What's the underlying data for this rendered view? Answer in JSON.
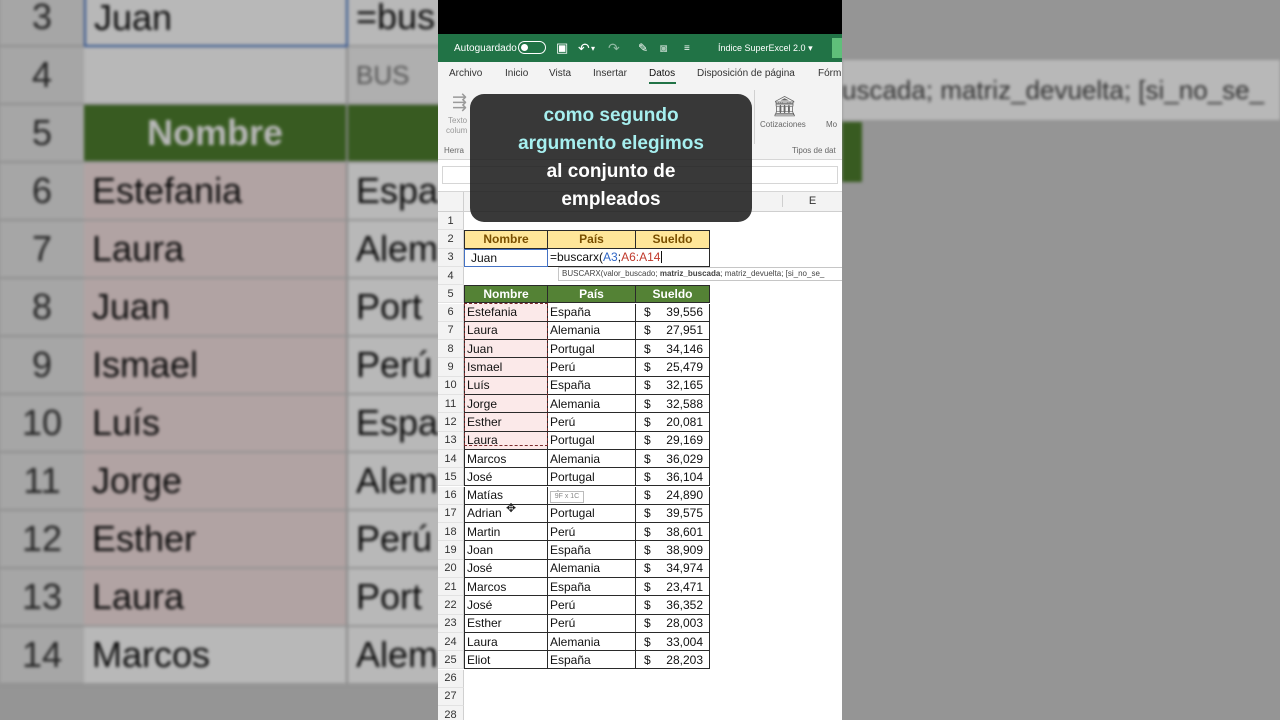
{
  "app": {
    "autosave_label": "Autoguardado",
    "workbook_title": "Índice SuperExcel 2.0",
    "title_chevron": "▾"
  },
  "ribbon": {
    "tabs": [
      "Archivo",
      "Inicio",
      "Vista",
      "Insertar",
      "Datos",
      "Disposición de página",
      "Fórm"
    ],
    "active_tab": "Datos",
    "group_left_btn1": "Texto",
    "group_left_btn2": "colum",
    "group_left_label": "Herra",
    "cotizaciones_label": "Cotizaciones",
    "more_label": "Mo",
    "tipos_label": "Tipos de dat"
  },
  "grid": {
    "col_e_header": "E",
    "lookup_header": [
      "Nombre",
      "País",
      "Sueldo"
    ],
    "lookup_value": "Juan",
    "formula_prefix": "=buscarx(",
    "formula_arg1": "A3",
    "formula_sep": ";",
    "formula_arg2": "A6:A14",
    "tooltip_fn": "BUSCARX(valor_buscado; ",
    "tooltip_bold": "matriz_buscada",
    "tooltip_rest": "; matriz_devuelta; [si_no_se_",
    "table_header": [
      "Nombre",
      "País",
      "Sueldo"
    ],
    "currency": "$",
    "range_size_tip": "9F x 1C",
    "rows": [
      {
        "n": "6",
        "name": "Estefania",
        "country": "España",
        "salary": "39,556"
      },
      {
        "n": "7",
        "name": "Laura",
        "country": "Alemania",
        "salary": "27,951"
      },
      {
        "n": "8",
        "name": "Juan",
        "country": "Portugal",
        "salary": "34,146"
      },
      {
        "n": "9",
        "name": "Ismael",
        "country": "Perú",
        "salary": "25,479"
      },
      {
        "n": "10",
        "name": "Luís",
        "country": "España",
        "salary": "32,165"
      },
      {
        "n": "11",
        "name": "Jorge",
        "country": "Alemania",
        "salary": "32,588"
      },
      {
        "n": "12",
        "name": "Esther",
        "country": "Perú",
        "salary": "20,081"
      },
      {
        "n": "13",
        "name": "Laura",
        "country": "Portugal",
        "salary": "29,169"
      },
      {
        "n": "14",
        "name": "Marcos",
        "country": "Alemania",
        "salary": "36,029"
      },
      {
        "n": "15",
        "name": "José",
        "country": "Portugal",
        "salary": "36,104"
      },
      {
        "n": "16",
        "name": "Matías",
        "country": "nia",
        "salary": "24,890"
      },
      {
        "n": "17",
        "name": "Adrian",
        "country": "Portugal",
        "salary": "39,575"
      },
      {
        "n": "18",
        "name": "Martin",
        "country": "Perú",
        "salary": "38,601"
      },
      {
        "n": "19",
        "name": "Joan",
        "country": "España",
        "salary": "38,909"
      },
      {
        "n": "20",
        "name": "José",
        "country": "Alemania",
        "salary": "34,974"
      },
      {
        "n": "21",
        "name": "Marcos",
        "country": "España",
        "salary": "23,471"
      },
      {
        "n": "22",
        "name": "José",
        "country": "Perú",
        "salary": "36,352"
      },
      {
        "n": "23",
        "name": "Esther",
        "country": "Perú",
        "salary": "28,003"
      },
      {
        "n": "24",
        "name": "Laura",
        "country": "Alemania",
        "salary": "33,004"
      },
      {
        "n": "25",
        "name": "Eliot",
        "country": "España",
        "salary": "28,203"
      }
    ],
    "extra_rows": [
      "26",
      "27",
      "28"
    ],
    "top_rows": [
      "1",
      "2",
      "3",
      "4",
      "5"
    ]
  },
  "caption": {
    "line1": "como segundo",
    "line2": "argumento elegimos",
    "line3": "al conjunto de",
    "line4": "empleados"
  },
  "background_left": {
    "rows": [
      {
        "n": "3",
        "a": "Juan",
        "b": "=bus"
      },
      {
        "n": "4",
        "a": "",
        "b": "BUS"
      },
      {
        "n": "5",
        "a": "Nombre",
        "b": ""
      },
      {
        "n": "6",
        "a": "Estefania",
        "b": "Espa"
      },
      {
        "n": "7",
        "a": "Laura",
        "b": "Alem"
      },
      {
        "n": "8",
        "a": "Juan",
        "b": "Port"
      },
      {
        "n": "9",
        "a": "Ismael",
        "b": "Perú"
      },
      {
        "n": "10",
        "a": "Luís",
        "b": "Espa"
      },
      {
        "n": "11",
        "a": "Jorge",
        "b": "Alem"
      },
      {
        "n": "12",
        "a": "Esther",
        "b": "Perú"
      },
      {
        "n": "13",
        "a": "Laura",
        "b": "Port"
      },
      {
        "n": "14",
        "a": "Marcos",
        "b": "Alem"
      }
    ]
  },
  "background_right": {
    "line": "uscada; matriz_devuelta; [si_no_se_"
  },
  "colors": {
    "excel_green": "#217346",
    "header_yellow": "#ffe699",
    "header_green": "#548235",
    "caption_cyan": "#a6efef"
  }
}
